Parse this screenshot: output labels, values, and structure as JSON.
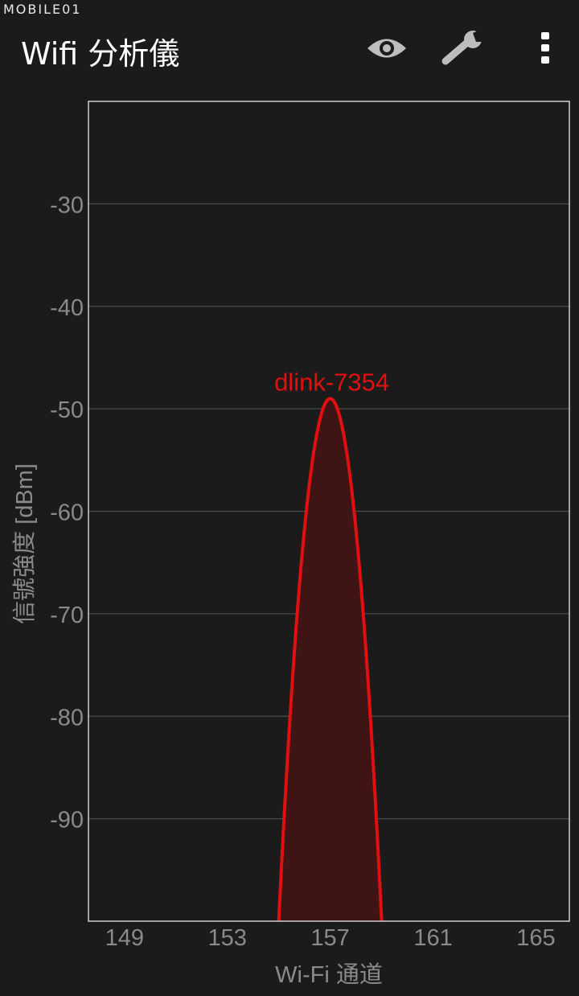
{
  "watermark": "MOBILE01",
  "app": {
    "title": "Wifi 分析儀"
  },
  "toolbar": {
    "view_icon": "eye-icon",
    "settings_icon": "wrench-icon",
    "overflow_icon": "more-vert-icon"
  },
  "colors": {
    "background": "#1b1b1b",
    "grid": "#4a4a4a",
    "axis_text": "#8a8a8a",
    "series": "#e01010",
    "series_fill": "#3e1414"
  },
  "chart_data": {
    "type": "area",
    "xlabel": "Wi-Fi 通道",
    "ylabel": "信號強度 [dBm]",
    "xlim": [
      147.6,
      166.3
    ],
    "ylim": [
      -100,
      -20
    ],
    "x_ticks": [
      149,
      153,
      157,
      161,
      165
    ],
    "y_ticks": [
      -30,
      -40,
      -50,
      -60,
      -70,
      -80,
      -90
    ],
    "grid": true,
    "series": [
      {
        "name": "dlink-7354",
        "center_channel": 157,
        "span_channels": [
          155,
          159
        ],
        "peak_dbm": -49,
        "floor_dbm": -100
      }
    ]
  }
}
